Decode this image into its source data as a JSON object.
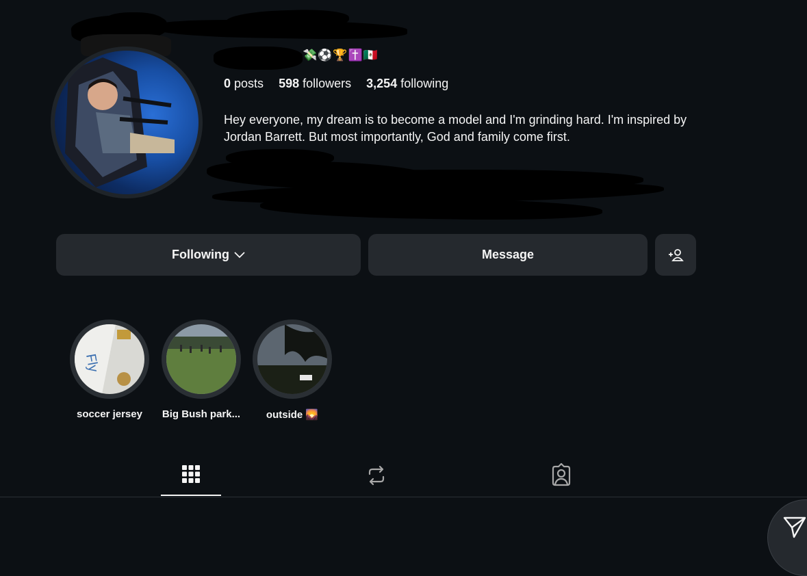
{
  "profile": {
    "name_emojis": "💸⚽🏆✝️🇲🇽",
    "stats": {
      "posts_count": "0",
      "posts_label": "posts",
      "followers_count": "598",
      "followers_label": "followers",
      "following_count": "3,254",
      "following_label": "following"
    },
    "bio": "Hey everyone, my dream is to become a model and I'm grinding hard. I'm inspired by Jordan Barrett. But most importantly, God and family come first."
  },
  "actions": {
    "following_label": "Following",
    "message_label": "Message",
    "add_user_icon": "person-add-icon"
  },
  "highlights": [
    {
      "label": "soccer jersey"
    },
    {
      "label": "Big Bush park..."
    },
    {
      "label": "outside 🌄"
    }
  ],
  "tabs": [
    {
      "icon": "grid-icon",
      "active": true
    },
    {
      "icon": "reposts-icon",
      "active": false
    },
    {
      "icon": "tagged-icon",
      "active": false
    }
  ],
  "colors": {
    "background": "#0c1014",
    "button": "#25292e",
    "text": "#f5f5f5"
  }
}
